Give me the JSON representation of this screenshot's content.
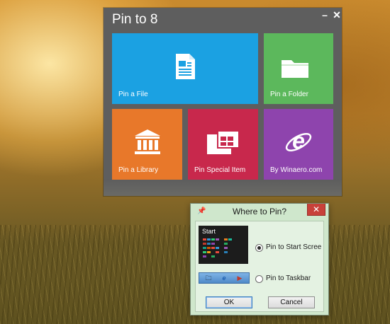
{
  "pin_window": {
    "title": "Pin to 8",
    "minimize_symbol": "–",
    "close_symbol": "✕",
    "tiles": [
      {
        "label": "Pin a File",
        "color": "#1ba1e2",
        "icon": "file-icon"
      },
      {
        "label": "Pin a Folder",
        "color": "#5cb85c",
        "icon": "folder-icon"
      },
      {
        "label": "Pin a Library",
        "color": "#e8782a",
        "icon": "library-icon"
      },
      {
        "label": "Pin Special Item",
        "color": "#c8284c",
        "icon": "special-item-icon"
      },
      {
        "label": "By Winaero.com",
        "color": "#8e44ad",
        "icon": "internet-explorer-icon"
      }
    ]
  },
  "dialog": {
    "title": "Where to Pin?",
    "close_symbol": "✕",
    "start_preview_label": "Start",
    "options": [
      {
        "label": "Pin to Start Scree",
        "selected": true
      },
      {
        "label": "Pin to Taskbar",
        "selected": false
      }
    ],
    "ok_label": "OK",
    "cancel_label": "Cancel"
  }
}
